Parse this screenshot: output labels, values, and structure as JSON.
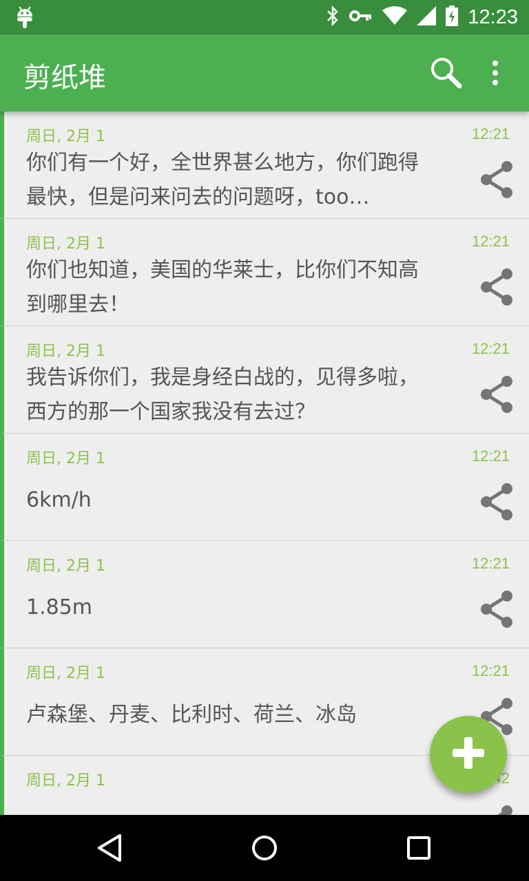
{
  "status_bar": {
    "time": "12:23",
    "icons": [
      "android-icon",
      "bluetooth-icon",
      "vpn-key-icon",
      "wifi-icon",
      "cell-signal-icon",
      "battery-charging-icon"
    ]
  },
  "app_bar": {
    "title": "剪纸堆",
    "actions": [
      "search-icon",
      "more-vert-icon"
    ]
  },
  "colors": {
    "status_bar": "#388e3c",
    "app_bar": "#4caf50",
    "accent": "#8bc34a",
    "background": "#eeeeee",
    "text": "#555555",
    "share_icon": "#757575"
  },
  "clips": [
    {
      "date": "周日, 2月 1",
      "time": "12:21",
      "text": "你们有一个好，全世界甚么地方，你们跑得最快，但是问来问去的问题呀，too…"
    },
    {
      "date": "周日, 2月 1",
      "time": "12:21",
      "text": "你们也知道，美国的华莱士，比你们不知高到哪里去！"
    },
    {
      "date": "周日, 2月 1",
      "time": "12:21",
      "text": "我告诉你们，我是身经白战的，见得多啦，西方的那一个国家我没有去过？"
    },
    {
      "date": "周日, 2月 1",
      "time": "12:21",
      "text": "6km/h"
    },
    {
      "date": "周日, 2月 1",
      "time": "12:21",
      "text": "1.85m"
    },
    {
      "date": "周日, 2月 1",
      "time": "12:21",
      "text": "卢森堡、丹麦、比利时、荷兰、冰岛"
    },
    {
      "date": "周日, 2月 1",
      "time": "12:42",
      "text": ""
    }
  ],
  "fab": {
    "icon": "add-icon"
  },
  "nav_bar": {
    "icons": [
      "back-icon",
      "home-icon",
      "recents-icon"
    ]
  }
}
